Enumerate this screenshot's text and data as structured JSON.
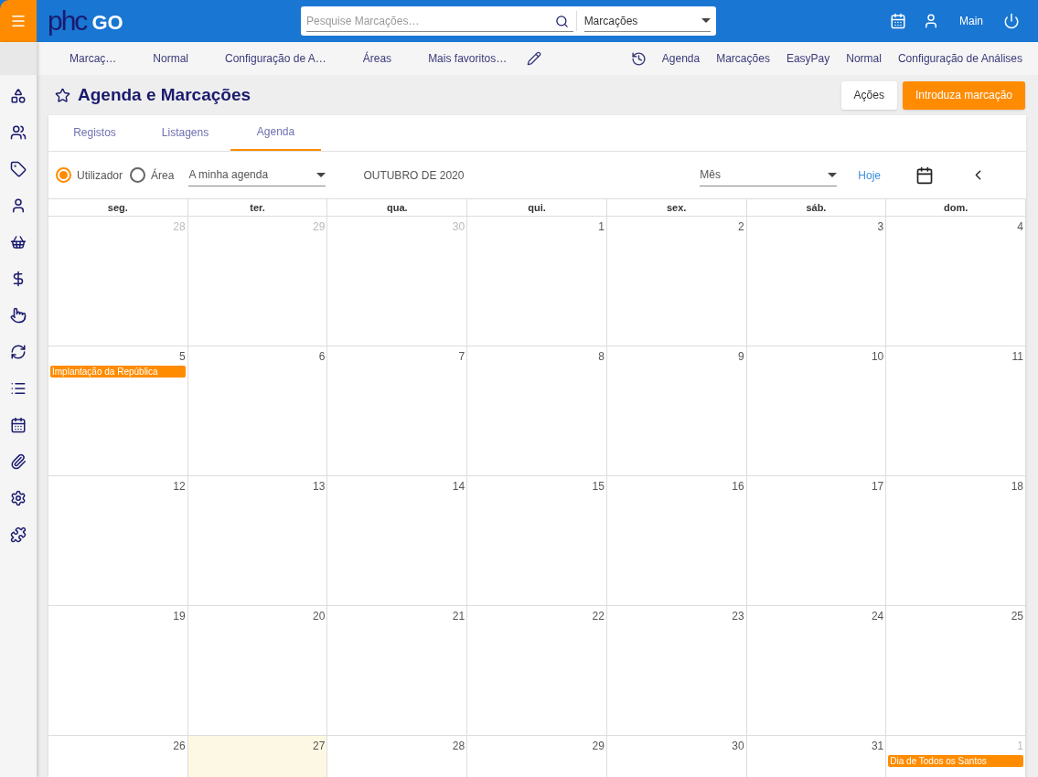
{
  "logo": {
    "mark": "phc",
    "name": "GO"
  },
  "search": {
    "placeholder": "Pesquise Marcações…",
    "scope": "Marcações"
  },
  "user": {
    "name": "Main"
  },
  "favorites": [
    "Marcaç…",
    "Normal",
    "Configuração de A…",
    "Áreas",
    "Mais favoritos…"
  ],
  "recent": [
    "Agenda",
    "Marcações",
    "EasyPay",
    "Normal",
    "Configuração de Análises"
  ],
  "page": {
    "title": "Agenda e Marcações",
    "favorite": false
  },
  "actions": [
    {
      "label": "Ações",
      "kind": "secondary"
    },
    {
      "label": "Introduza marcação",
      "kind": "primary"
    }
  ],
  "tabs": [
    {
      "label": "Registos",
      "selected": false
    },
    {
      "label": "Listagens",
      "selected": false
    },
    {
      "label": "Agenda",
      "selected": true
    }
  ],
  "filter": {
    "options": [
      {
        "label": "Utilizador",
        "selected": true
      },
      {
        "label": "Área",
        "selected": false
      }
    ],
    "agenda": "A minha agenda",
    "period_label": "OUTUBRO DE 2020",
    "view": "Mês",
    "today_link": "Hoje"
  },
  "calendar": {
    "weekdays": [
      "seg.",
      "ter.",
      "qua.",
      "qui.",
      "sex.",
      "sáb.",
      "dom."
    ],
    "weeks": [
      [
        {
          "day": "28",
          "muted": true
        },
        {
          "day": "29",
          "muted": true
        },
        {
          "day": "30",
          "muted": true
        },
        {
          "day": "1"
        },
        {
          "day": "2"
        },
        {
          "day": "3"
        },
        {
          "day": "4"
        }
      ],
      [
        {
          "day": "5",
          "events": [
            {
              "title": "Implantação da República",
              "color": "#ff8c00"
            }
          ]
        },
        {
          "day": "6"
        },
        {
          "day": "7"
        },
        {
          "day": "8"
        },
        {
          "day": "9"
        },
        {
          "day": "10"
        },
        {
          "day": "11"
        }
      ],
      [
        {
          "day": "12"
        },
        {
          "day": "13"
        },
        {
          "day": "14"
        },
        {
          "day": "15"
        },
        {
          "day": "16"
        },
        {
          "day": "17"
        },
        {
          "day": "18"
        }
      ],
      [
        {
          "day": "19"
        },
        {
          "day": "20"
        },
        {
          "day": "21"
        },
        {
          "day": "22"
        },
        {
          "day": "23"
        },
        {
          "day": "24"
        },
        {
          "day": "25"
        }
      ],
      [
        {
          "day": "26"
        },
        {
          "day": "27",
          "today": true
        },
        {
          "day": "28"
        },
        {
          "day": "29"
        },
        {
          "day": "30"
        },
        {
          "day": "31"
        },
        {
          "day": "1",
          "muted": true,
          "events": [
            {
              "title": "Dia de Todos os Santos",
              "color": "#ff8c00"
            }
          ]
        }
      ]
    ]
  }
}
